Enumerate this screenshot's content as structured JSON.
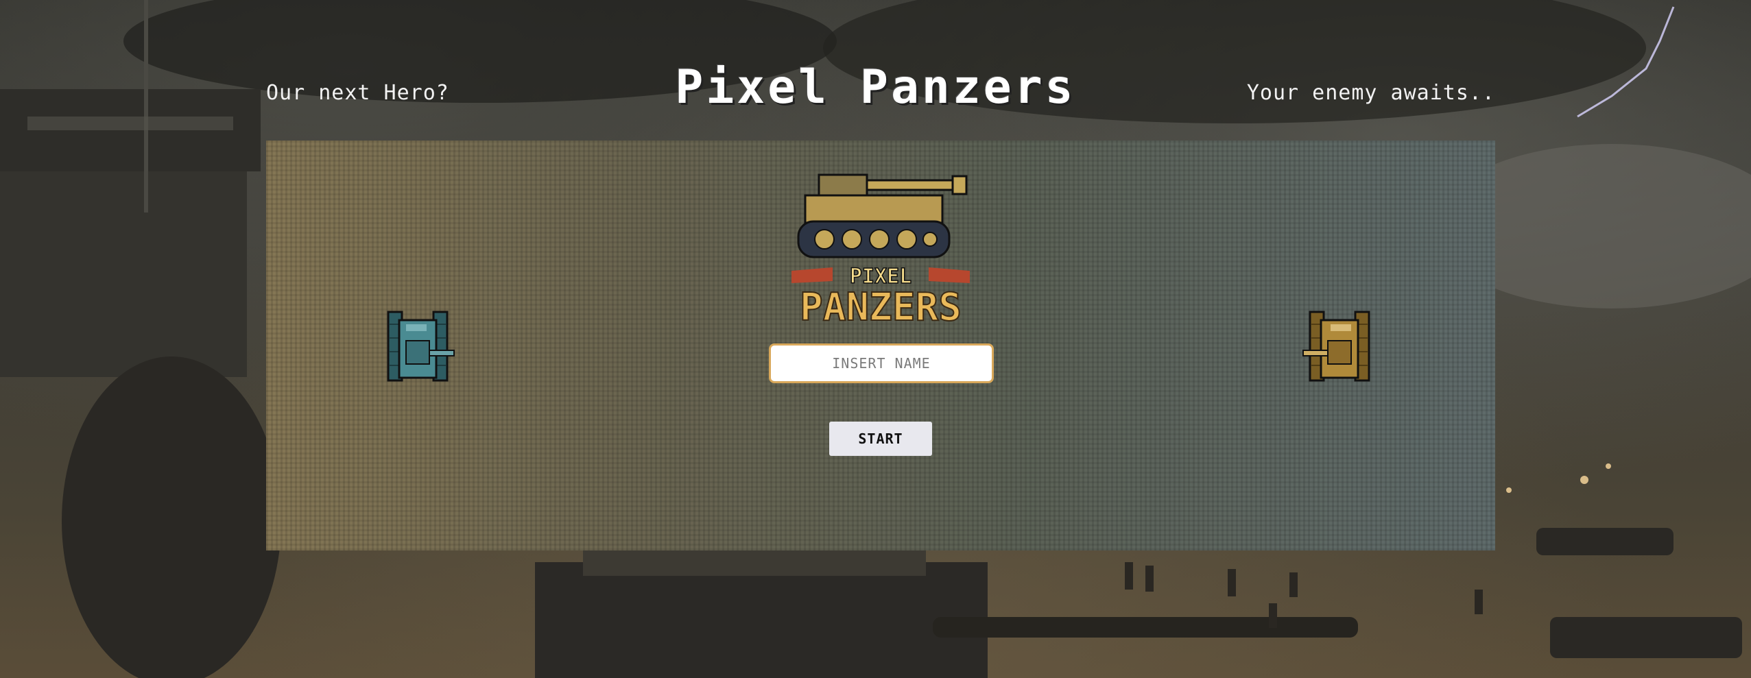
{
  "header": {
    "left_text": "Our next Hero?",
    "title": "Pixel Panzers",
    "right_text": "Your enemy awaits.."
  },
  "logo": {
    "line1": "PIXEL",
    "line2": "PANZERS"
  },
  "form": {
    "name_placeholder": "INSERT NAME",
    "name_value": "",
    "start_label": "START"
  },
  "icons": {
    "player_tank": "blue-tank-icon",
    "enemy_tank": "gold-tank-icon"
  },
  "colors": {
    "player_tank": "#3f7f86",
    "enemy_tank": "#b08a3a",
    "input_border": "#d9a85a",
    "title": "#ffffff"
  }
}
